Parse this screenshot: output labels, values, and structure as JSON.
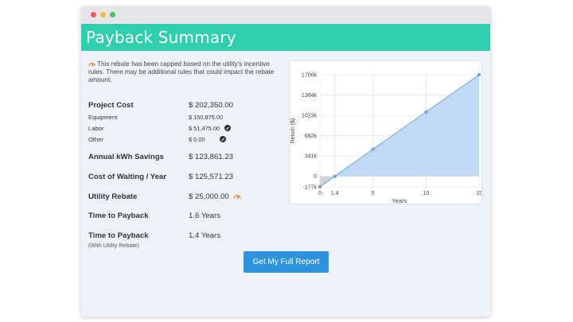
{
  "window": {
    "controls": [
      "close",
      "minimize",
      "maximize"
    ]
  },
  "header": {
    "title": "Payback Summary"
  },
  "notice": {
    "text": "This rebate has been capped based on the utility's incentive rules. There may be additional rules that could impact the rebate amount.",
    "icon": "gauge-icon"
  },
  "summary": {
    "project_cost": {
      "label": "Project Cost",
      "value": "$ 202,350.00"
    },
    "equipment": {
      "label": "Equipment",
      "value": "$ 150,875.00"
    },
    "labor": {
      "label": "Labor",
      "value": "$ 51,475.00"
    },
    "other": {
      "label": "Other",
      "value": "$ 0.00"
    },
    "annual_kwh_savings": {
      "label": "Annual kWh Savings",
      "value": "$ 123,861.23"
    },
    "cost_of_waiting": {
      "label": "Cost of Waiting / Year",
      "value": "$ 125,571.23"
    },
    "utility_rebate": {
      "label": "Utility Rebate",
      "value": "$ 25,000.00"
    },
    "time_to_payback": {
      "label": "Time to Payback",
      "value": "1.6 Years"
    },
    "time_to_payback_rebate": {
      "label": "Time to Payback",
      "note": "(With Utility Rebate)",
      "value": "1.4 Years"
    }
  },
  "actions": {
    "report_button": "Get My Full Report"
  },
  "colors": {
    "header": "#2fcfad",
    "button": "#2d93dd",
    "area_fill": "#bcd6f3",
    "line": "#7ab2e6"
  },
  "chart_data": {
    "type": "area",
    "xlabel": "Years",
    "ylabel": "Return ($)",
    "x_ticks": [
      "0",
      "1.4",
      "5",
      "10",
      "15"
    ],
    "y_ticks": [
      "-177k",
      "0",
      "341k",
      "682k",
      "1023k",
      "1364k",
      "1706k"
    ],
    "xlim": [
      0,
      15
    ],
    "ylim": [
      -177,
      1706
    ],
    "grid": true,
    "series": [
      {
        "x": [
          0,
          1.4,
          5,
          10,
          15
        ],
        "y": [
          -177,
          0,
          455,
          1080,
          1706
        ]
      }
    ]
  }
}
